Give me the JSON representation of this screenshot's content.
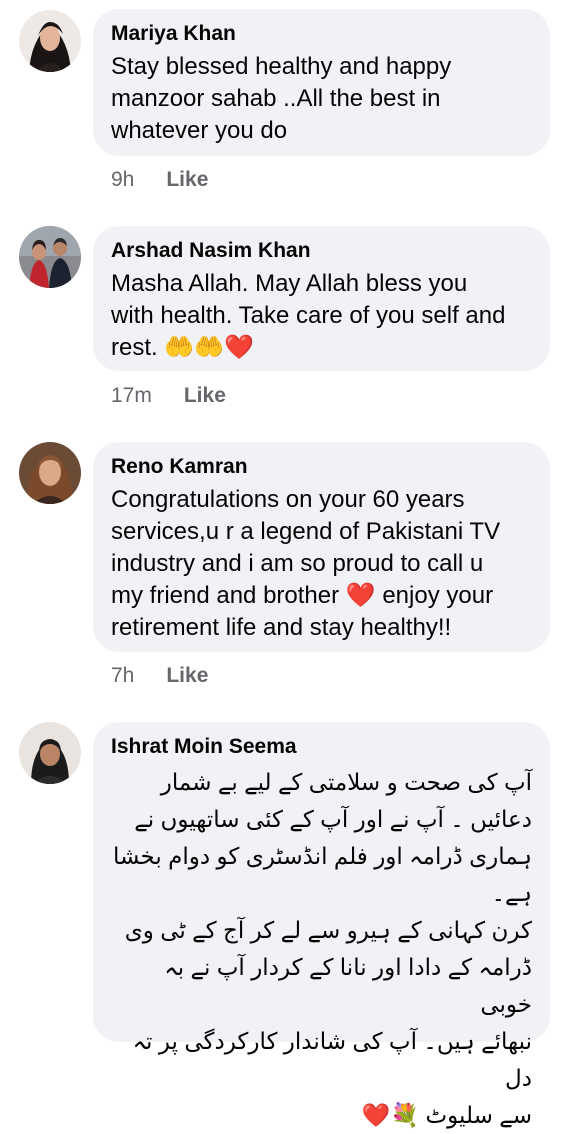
{
  "comments": [
    {
      "author": "Mariya Khan",
      "text": "Stay blessed healthy and happy\nmanzoor sahab ..All the best in\nwhatever you do",
      "time": "9h",
      "like_label": "Like"
    },
    {
      "author": "Arshad Nasim Khan",
      "text": "Masha Allah. May Allah bless you\nwith health. Take care of you self and\nrest. 🤲🤲❤️",
      "time": "17m",
      "like_label": "Like"
    },
    {
      "author": "Reno Kamran",
      "text": "Congratulations on your 60 years\nservices,u r a legend of Pakistani TV\nindustry and i am so  proud to call u\nmy friend and brother ❤️ enjoy your\nretirement life and stay healthy!!",
      "time": "7h",
      "like_label": "Like"
    },
    {
      "author": "Ishrat Moin Seema",
      "text": "آپ کی صحت و سلامتی کے لیے بے شمار\nدعائیں ۔ آپ نے اور آپ کے کئی ساتھیوں نے\nہماری ڈرامہ اور فلم انڈسٹری کو دوام بخشا ہے۔\nکرن کہانی کے ہیرو سے لے کر آج کے ٹی وی\nڈرامہ کے دادا اور نانا کے کردار آپ نے بہ خوبی\nنبھائے ہیں۔ آپ کی شاندار کارکردگی پر تہ دل\nسے سلیوٹ 💐❤️"
    }
  ]
}
